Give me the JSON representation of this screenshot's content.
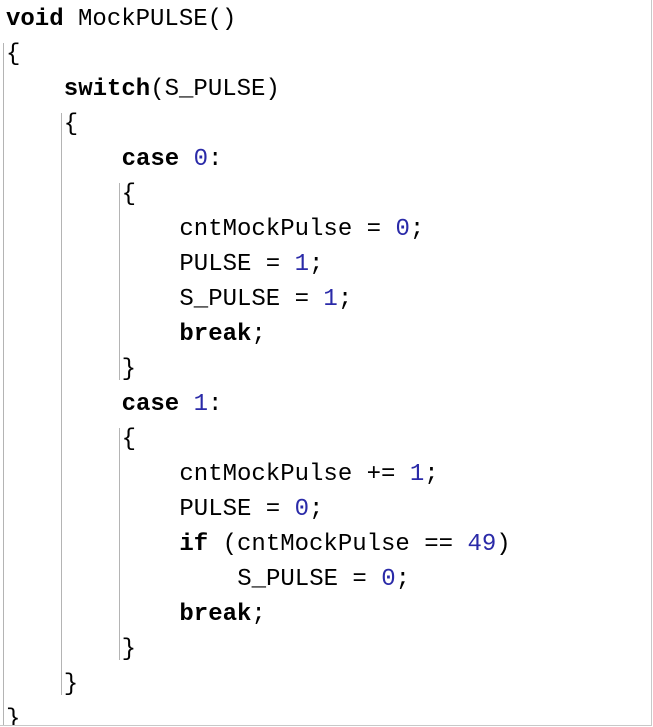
{
  "editor": {
    "colors": {
      "keyword": "#000000",
      "number": "#2a2aa8",
      "plain": "#000000",
      "guide": "#b4b4b4"
    },
    "lines": [
      {
        "indent": 0,
        "tokens": [
          {
            "t": "keyword",
            "v": "void"
          },
          {
            "t": "plain",
            "v": " MockPULSE()"
          }
        ]
      },
      {
        "indent": 0,
        "tokens": [
          {
            "t": "plain",
            "v": "{"
          }
        ]
      },
      {
        "indent": 4,
        "tokens": [
          {
            "t": "keyword",
            "v": "switch"
          },
          {
            "t": "plain",
            "v": "(S_PULSE)"
          }
        ]
      },
      {
        "indent": 4,
        "tokens": [
          {
            "t": "plain",
            "v": "{"
          }
        ]
      },
      {
        "indent": 8,
        "tokens": [
          {
            "t": "keyword",
            "v": "case"
          },
          {
            "t": "plain",
            "v": " "
          },
          {
            "t": "number",
            "v": "0"
          },
          {
            "t": "plain",
            "v": ":"
          }
        ]
      },
      {
        "indent": 8,
        "tokens": [
          {
            "t": "plain",
            "v": "{"
          }
        ]
      },
      {
        "indent": 12,
        "tokens": [
          {
            "t": "plain",
            "v": "cntMockPulse = "
          },
          {
            "t": "number",
            "v": "0"
          },
          {
            "t": "plain",
            "v": ";"
          }
        ]
      },
      {
        "indent": 12,
        "tokens": [
          {
            "t": "plain",
            "v": "PULSE = "
          },
          {
            "t": "number",
            "v": "1"
          },
          {
            "t": "plain",
            "v": ";"
          }
        ]
      },
      {
        "indent": 12,
        "tokens": [
          {
            "t": "plain",
            "v": "S_PULSE = "
          },
          {
            "t": "number",
            "v": "1"
          },
          {
            "t": "plain",
            "v": ";"
          }
        ]
      },
      {
        "indent": 12,
        "tokens": [
          {
            "t": "keyword",
            "v": "break"
          },
          {
            "t": "plain",
            "v": ";"
          }
        ]
      },
      {
        "indent": 8,
        "tokens": [
          {
            "t": "plain",
            "v": "}"
          }
        ]
      },
      {
        "indent": 8,
        "tokens": [
          {
            "t": "keyword",
            "v": "case"
          },
          {
            "t": "plain",
            "v": " "
          },
          {
            "t": "number",
            "v": "1"
          },
          {
            "t": "plain",
            "v": ":"
          }
        ]
      },
      {
        "indent": 8,
        "tokens": [
          {
            "t": "plain",
            "v": "{"
          }
        ]
      },
      {
        "indent": 12,
        "tokens": [
          {
            "t": "plain",
            "v": "cntMockPulse += "
          },
          {
            "t": "number",
            "v": "1"
          },
          {
            "t": "plain",
            "v": ";"
          }
        ]
      },
      {
        "indent": 12,
        "tokens": [
          {
            "t": "plain",
            "v": "PULSE = "
          },
          {
            "t": "number",
            "v": "0"
          },
          {
            "t": "plain",
            "v": ";"
          }
        ]
      },
      {
        "indent": 12,
        "tokens": [
          {
            "t": "keyword",
            "v": "if"
          },
          {
            "t": "plain",
            "v": " (cntMockPulse == "
          },
          {
            "t": "number",
            "v": "49"
          },
          {
            "t": "plain",
            "v": ")"
          }
        ]
      },
      {
        "indent": 16,
        "tokens": [
          {
            "t": "plain",
            "v": "S_PULSE = "
          },
          {
            "t": "number",
            "v": "0"
          },
          {
            "t": "plain",
            "v": ";"
          }
        ]
      },
      {
        "indent": 12,
        "tokens": [
          {
            "t": "keyword",
            "v": "break"
          },
          {
            "t": "plain",
            "v": ";"
          }
        ]
      },
      {
        "indent": 8,
        "tokens": [
          {
            "t": "plain",
            "v": "}"
          }
        ]
      },
      {
        "indent": 4,
        "tokens": [
          {
            "t": "plain",
            "v": "}"
          }
        ]
      },
      {
        "indent": 0,
        "tokens": [
          {
            "t": "plain",
            "v": "}"
          }
        ]
      }
    ]
  }
}
